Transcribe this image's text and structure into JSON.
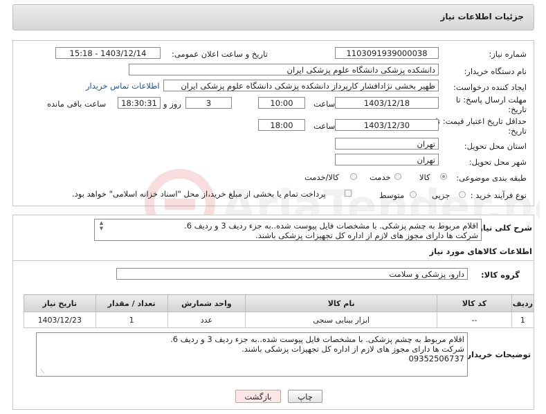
{
  "header": {
    "title": "جزئیات اطلاعات نیاز"
  },
  "form": {
    "need_number_label": "شماره نیاز:",
    "need_number": "1103091939000038",
    "announce_label": "تاریخ و ساعت اعلان عمومی:",
    "announce_value": "1403/12/14 - 15:18",
    "buyer_org_label": "نام دستگاه خریدار:",
    "buyer_org": "دانشکده پزشکی دانشگاه علوم پزشکی ایران",
    "creator_label": "ایجاد کننده درخواست:",
    "creator": "ظهیر بخشی نژادافشار کارپرداز دانشکده پزشکی دانشگاه علوم پزشکی ایران",
    "contact_link": "اطلاعات تماس خریدار",
    "deadline_label_1": "مهلت ارسال پاسخ: تا",
    "deadline_label_2": "تاریخ:",
    "deadline_date": "1403/12/18",
    "time_label": "ساعت",
    "deadline_time": "10:00",
    "days_value": "3",
    "days_label": "روز و",
    "remaining_time": "18:30:31",
    "remaining_label": "ساعت باقی مانده",
    "validity_label_1": "حداقل تاریخ اعتبار قیمت: تا",
    "validity_label_2": "تاریخ:",
    "validity_date": "1403/12/30",
    "validity_time": "18:00",
    "province_label": "استان محل تحویل:",
    "province": "تهران",
    "city_label": "شهر محل تحویل:",
    "city": "تهران",
    "category_label": "طبقه بندی موضوعی:",
    "category_options": [
      "کالا",
      "خدمت",
      "کالا/خدمت"
    ],
    "process_label": "نوع فرآیند خرید :",
    "process_options": [
      "جزیی",
      "متوسط"
    ],
    "process_note": "پرداخت تمام یا بخشی از مبلغ خرید،از محل \"اسناد خزانه اسلامی\" خواهد بود."
  },
  "description": {
    "label": "شرح کلی نیاز:",
    "line1": "اقلام مربوط به چشم پزشکی. با مشخصات فایل پیوست شده..به جزء ردیف 3 و ردیف 6.",
    "line2": "شرکت ها دارای مجوز های لازم از اداره کل تجهیزات پزشکی باشند."
  },
  "goods": {
    "section_title": "اطلاعات کالاهای مورد نیاز",
    "group_label": "گروه کالا:",
    "group_value": "دارو، پزشکی و سلامت"
  },
  "table": {
    "headers": [
      "ردیف",
      "کد کالا",
      "نام کالا",
      "واحد شمارش",
      "تعداد / مقدار",
      "تاریخ نیاز"
    ],
    "rows": [
      [
        "1",
        "--",
        "ابزار بینایی سنجی",
        "عدد",
        "1",
        "1403/12/23"
      ]
    ]
  },
  "buyer_notes": {
    "label": "توضیحات خریدار:",
    "line1": "اقلام مربوط به چشم پزشکی. با مشخصات فایل پیوست شده..به جزء ردیف 3 و ردیف 6.",
    "line2": "شرکت ها دارای مجوز های لازم از اداره کل تجهیزات پزشکی باشند.",
    "line3": "09352506737"
  },
  "buttons": {
    "print": "چاپ",
    "back": "بازگشت"
  },
  "watermark": {
    "text": "AriaTender.neT"
  }
}
